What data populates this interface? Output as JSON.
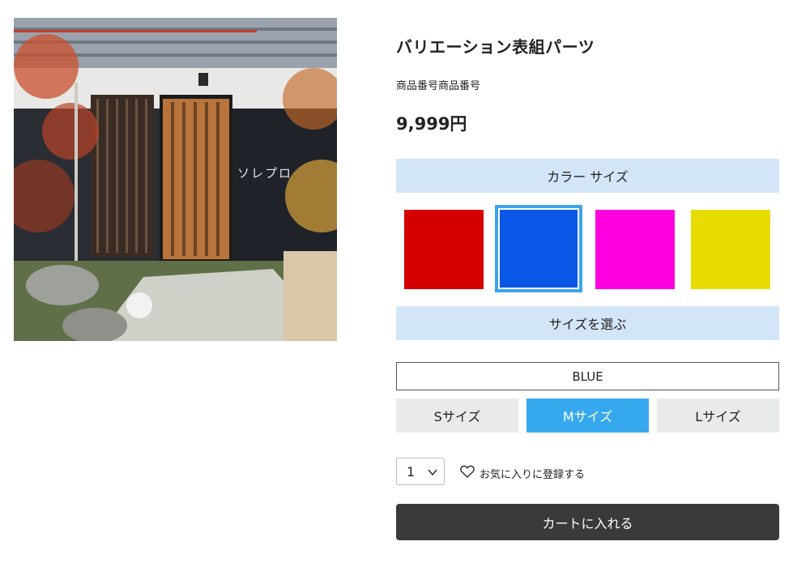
{
  "product": {
    "title": "バリエーション表組パーツ",
    "sku": "商品番号商品番号",
    "price": "9,999円",
    "image_sign": "ソレプロ"
  },
  "options": {
    "color_header": "カラー サイズ",
    "swatches": [
      {
        "name": "red",
        "color": "#d40000"
      },
      {
        "name": "blue",
        "color": "#0a56e6",
        "selected": true
      },
      {
        "name": "magenta",
        "color": "#ff00e0"
      },
      {
        "name": "yellow",
        "color": "#e6dc00"
      }
    ],
    "size_header": "サイズを選ぶ",
    "selected_color_label": "BLUE",
    "sizes": [
      {
        "label": "Sサイズ",
        "selected": false
      },
      {
        "label": "Mサイズ",
        "selected": true
      },
      {
        "label": "Lサイズ",
        "selected": false
      }
    ],
    "accent_color": "#36a9ee",
    "header_bg": "#d3e6f8"
  },
  "purchase": {
    "quantity": "1",
    "favorite_label": "お気に入りに登録する",
    "cart_button_label": "カートに入れる"
  }
}
